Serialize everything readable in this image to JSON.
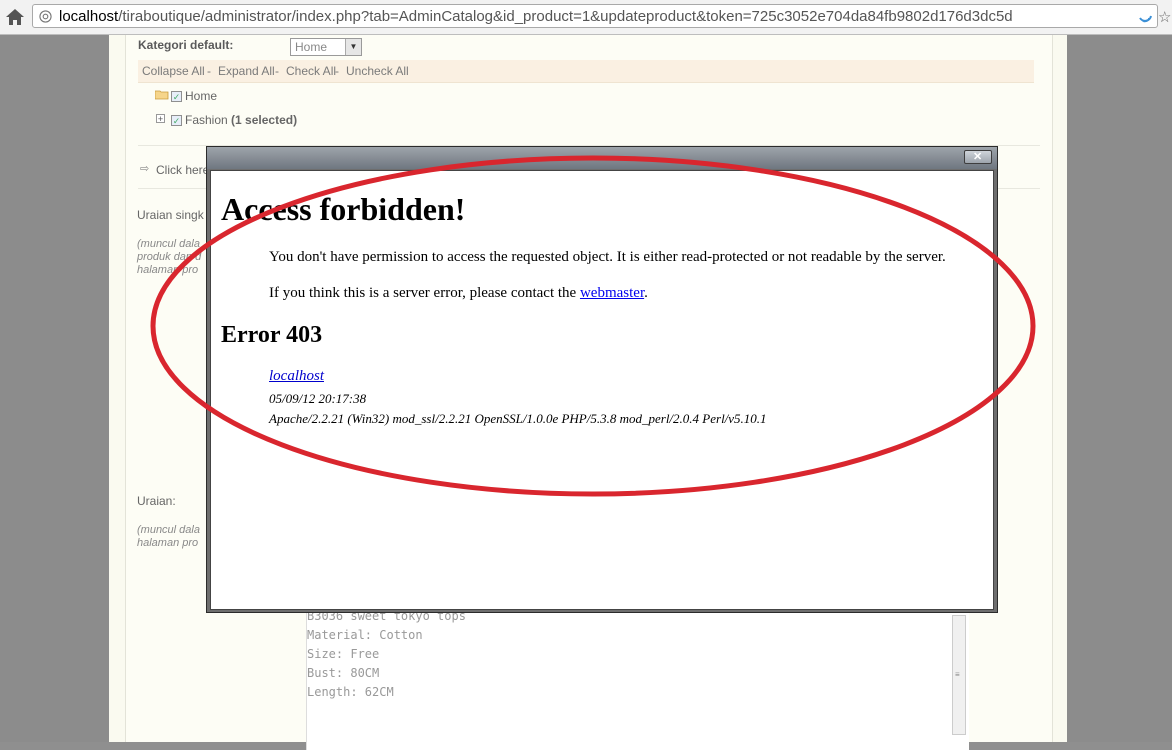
{
  "browser": {
    "url_host": "localhost",
    "url_path": "/tiraboutique/administrator/index.php?tab=AdminCatalog&id_product=1&updateproduct&token=725c3052e704da84fb9802d176d3dc5d"
  },
  "form": {
    "kategori_label": "Kategori default:",
    "kategori_value": "Home",
    "tree_actions": [
      "Collapse All",
      "Expand All",
      "Check All",
      "Uncheck All"
    ],
    "tree_separator": " - ",
    "tree_home": "Home",
    "tree_fashion": "Fashion",
    "tree_fashion_count": "(1 selected)",
    "click_here": "Click here",
    "short_desc_label": "Uraian singk",
    "short_desc_note": [
      "(muncul dala",
      "produk dan d",
      "halaman pro"
    ],
    "desc_label": "Uraian:",
    "desc_note": [
      "(muncul dala",
      "halaman pro"
    ],
    "textarea_lines": [
      "B3036 sweet tokyo tops",
      "Material: Cotton",
      "Size: Free",
      "Bust: 80CM",
      "Length: 62CM"
    ]
  },
  "error_page": {
    "title": "Access forbidden!",
    "message": "You don't have permission to access the requested object. It is either read-protected or not readable by the server.",
    "contact_prefix": "If you think this is a server error, please contact the ",
    "contact_link": "webmaster",
    "contact_suffix": ".",
    "error_code": "Error 403",
    "server_host": "localhost",
    "timestamp": "05/09/12 20:17:38",
    "server_signature": "Apache/2.2.21 (Win32) mod_ssl/2.2.21 OpenSSL/1.0.0e PHP/5.3.8 mod_perl/2.0.4 Perl/v5.10.1"
  },
  "annotation": {
    "color": "#d9262e"
  }
}
